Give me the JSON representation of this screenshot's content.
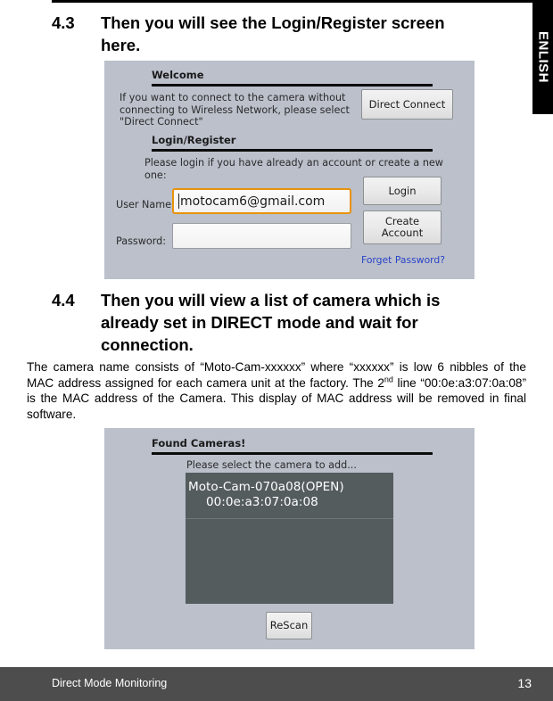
{
  "page": {
    "language_tab": "ENLISH",
    "footer_left": "Direct Mode Monitoring",
    "footer_page_number": "13",
    "accent_focus_color": "#e8930c",
    "panel_color": "#bbc0cb",
    "list_color": "#555c5e",
    "link_color": "#2b44c7",
    "footer_color": "#4d4d4d"
  },
  "steps": [
    {
      "number": "4.3",
      "text": "Then you will see the Login/Register screen here."
    },
    {
      "number": "4.4",
      "text": "Then you will view a list of camera which is already set in DIRECT mode and wait for connection."
    }
  ],
  "paragraph": {
    "part1": "The camera name consists of “Moto-Cam-xxxxxx” where “xxxxxx” is low 6 nibbles of the MAC address assigned for each camera unit at the factory. The 2",
    "superscript": "nd",
    "part2": " line “00:0e:a3:07:0a:08” is the MAC address of the Camera.  This display of MAC address will be removed in final software."
  },
  "login_screen": {
    "welcome_heading": "Welcome",
    "welcome_text": "If you want to connect to the camera without connecting to Wireless Network, please select \"Direct Connect\"",
    "direct_connect_button": "Direct Connect",
    "login_register_heading": "Login/Register",
    "login_register_text": "Please login if you have already an account or create a new one:",
    "username_label": "User Name:",
    "username_value": "motocam6@gmail.com",
    "password_label": "Password:",
    "password_value": "",
    "login_button": "Login",
    "create_account_button": "Create Account",
    "forget_password_link": "Forget Password?"
  },
  "found_cameras_screen": {
    "heading": "Found Cameras!",
    "instruction": "Please select the camera to add...",
    "cameras": [
      {
        "name": "Moto-Cam-070a08(OPEN)",
        "mac": "00:0e:a3:07:0a:08"
      }
    ],
    "rescan_button": "ReScan"
  }
}
